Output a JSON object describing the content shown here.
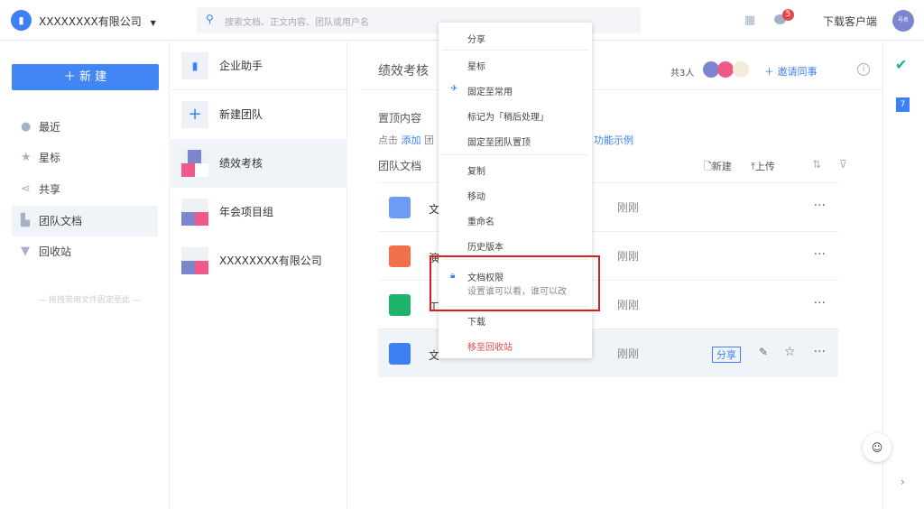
{
  "header": {
    "company": "XXXXXXXX有限公司",
    "search_placeholder": "搜索文档、正文内容、团队或用户名",
    "notif_count": "5",
    "download": "下载客户端",
    "avatar": "号名"
  },
  "sidebar": {
    "new_button": "新 建",
    "items": [
      {
        "label": "最近",
        "icon": "clock-icon"
      },
      {
        "label": "星标",
        "icon": "star-icon"
      },
      {
        "label": "共享",
        "icon": "share-icon"
      },
      {
        "label": "团队文档",
        "icon": "team-docs-icon"
      },
      {
        "label": "回收站",
        "icon": "trash-icon"
      }
    ],
    "drop_hint": "拖拽常用文件固定至此"
  },
  "teams": [
    {
      "label": "企业助手"
    },
    {
      "label": "新建团队"
    },
    {
      "label": "绩效考核"
    },
    {
      "label": "年会项目组"
    },
    {
      "label": "XXXXXXXX有限公司"
    }
  ],
  "main": {
    "title": "绩效考核",
    "members": "共3人",
    "invite": "邀请同事",
    "pinned_title": "置顶内容",
    "pinned_hint_prefix": "点击",
    "pinned_add": "添加",
    "pinned_partial": "团",
    "pinned_example": "功能示例",
    "docs_title": "团队文档",
    "new": "新建",
    "upload": "上传",
    "files": [
      {
        "name": "文",
        "time": "刚刚",
        "type": "folder"
      },
      {
        "name": "演",
        "time": "刚刚",
        "type": "slides"
      },
      {
        "name": "工",
        "time": "刚刚",
        "type": "sheet"
      },
      {
        "name": "文",
        "time": "刚刚",
        "type": "doc"
      }
    ],
    "share": "分享"
  },
  "menu": {
    "items": [
      "分享",
      "星标",
      "固定至常用",
      "标记为「稍后处理」",
      "固定至团队置顶",
      "复制",
      "移动",
      "重命名",
      "历史版本",
      "文档权限",
      "下载",
      "移至回收站"
    ],
    "perm_desc": "设置谁可以看，谁可以改"
  },
  "colors": {
    "accent": "#4285f4",
    "danger": "#e5454b",
    "highlight_box": "#e21b22"
  }
}
